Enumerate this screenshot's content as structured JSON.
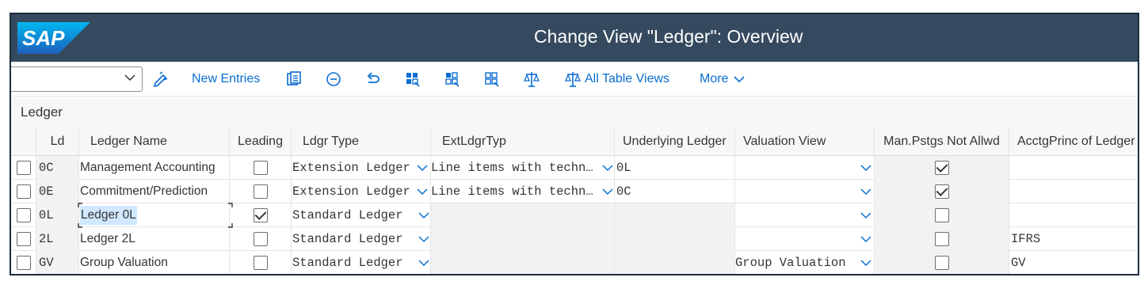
{
  "app": {
    "logo": "SAP",
    "title": "Change View \"Ledger\": Overview"
  },
  "toolbar": {
    "select_value": "",
    "items": [
      {
        "icon": "edit-icon",
        "label": ""
      },
      {
        "icon": "new-entries-icon",
        "label": "New Entries"
      },
      {
        "icon": "copy-icon",
        "label": ""
      },
      {
        "icon": "delete-icon",
        "label": ""
      },
      {
        "icon": "undo-icon",
        "label": ""
      },
      {
        "icon": "select-all-icon",
        "label": ""
      },
      {
        "icon": "select-block-icon",
        "label": ""
      },
      {
        "icon": "deselect-all-icon",
        "label": ""
      },
      {
        "icon": "compare-icon",
        "label": ""
      },
      {
        "icon": "table-views-icon",
        "label": "All Table Views"
      },
      {
        "icon": "chevron-down-icon",
        "label": "More"
      }
    ]
  },
  "section": {
    "title": "Ledger"
  },
  "table": {
    "columns": [
      "Ld",
      "Ledger Name",
      "Leading",
      "Ldgr Type",
      "ExtLdgrTyp",
      "Underlying Ledger",
      "Valuation View",
      "Man.Pstgs Not Allwd",
      "AcctgPrinc of Ledger"
    ],
    "rows": [
      {
        "ld": "0C",
        "name": "Management Accounting",
        "leading": false,
        "type": "Extension Ledger",
        "ext": "Line items with techn…",
        "underlying": "0L",
        "valuation": "",
        "man": true,
        "princ": ""
      },
      {
        "ld": "0E",
        "name": "Commitment/Prediction",
        "leading": false,
        "type": "Extension Ledger",
        "ext": "Line items with techn…",
        "underlying": "0C",
        "valuation": "",
        "man": true,
        "princ": ""
      },
      {
        "ld": "0L",
        "name": "Ledger 0L",
        "leading": true,
        "type": "Standard Ledger",
        "ext": "",
        "underlying": "",
        "valuation": "",
        "man": false,
        "princ": ""
      },
      {
        "ld": "2L",
        "name": "Ledger 2L",
        "leading": false,
        "type": "Standard Ledger",
        "ext": "",
        "underlying": "",
        "valuation": "",
        "man": false,
        "princ": "IFRS"
      },
      {
        "ld": "GV",
        "name": "Group Valuation",
        "leading": false,
        "type": "Standard Ledger",
        "ext": "",
        "underlying": "",
        "valuation": "Group Valuation",
        "man": false,
        "princ": "GV"
      }
    ]
  },
  "colors": {
    "shell": "#354a5f",
    "accent": "#0a6ed1",
    "text": "#32363a",
    "selection": "#d1e8ff"
  }
}
